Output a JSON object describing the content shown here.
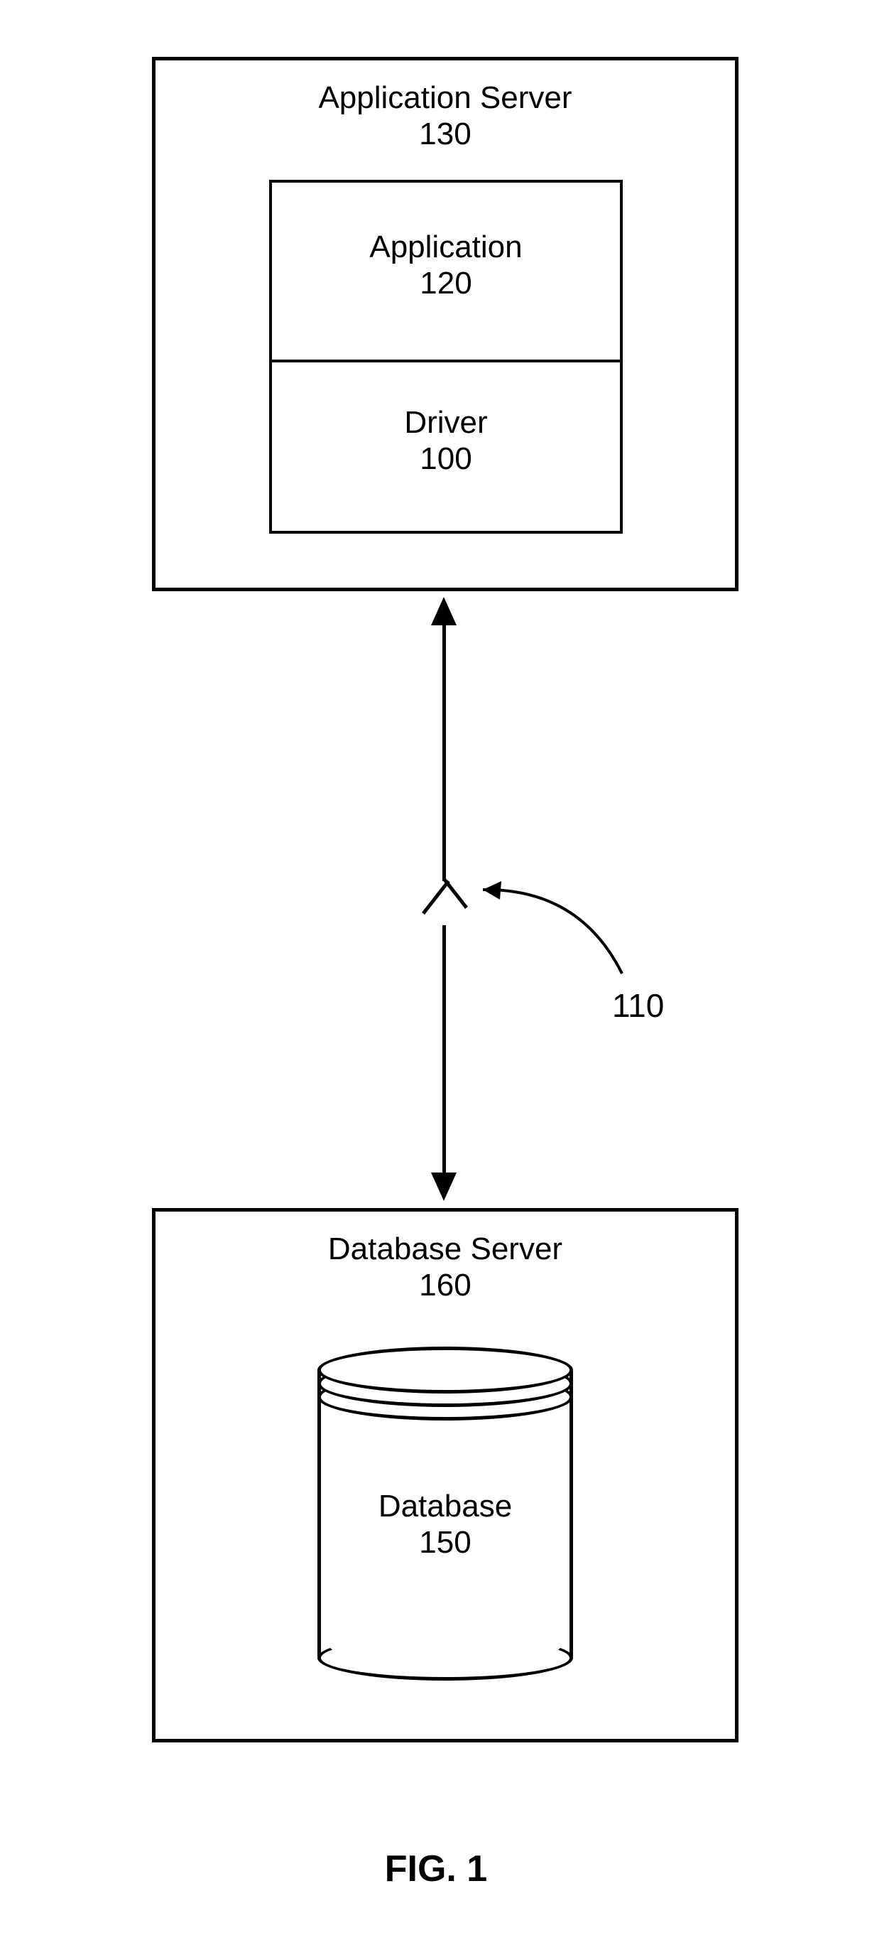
{
  "app_server": {
    "title": "Application Server",
    "number": "130",
    "application": {
      "title": "Application",
      "number": "120"
    },
    "driver": {
      "title": "Driver",
      "number": "100"
    }
  },
  "db_server": {
    "title": "Database Server",
    "number": "160",
    "database": {
      "title": "Database",
      "number": "150"
    }
  },
  "connection_label": "110",
  "figure_label": "FIG. 1"
}
